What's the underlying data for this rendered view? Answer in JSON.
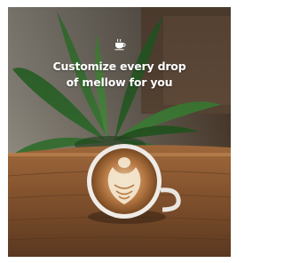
{
  "hero": {
    "icon": "coffee-cup-icon",
    "line1": "Customize every drop",
    "line2": "of mellow for you"
  },
  "colors": {
    "text": "#ffffff",
    "wood": "#8a5a34",
    "plant": "#2e6b2f"
  }
}
